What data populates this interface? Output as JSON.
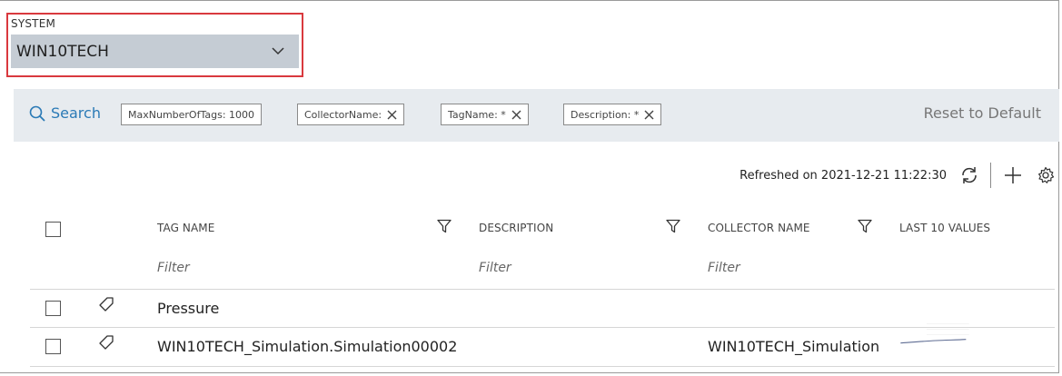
{
  "system": {
    "label": "SYSTEM",
    "selected": "WIN10TECH"
  },
  "search": {
    "link_label": "Search",
    "chips": [
      {
        "label": "MaxNumberOfTags: 1000",
        "removable": false
      },
      {
        "label": "CollectorName:",
        "removable": true
      },
      {
        "label": "TagName: *",
        "removable": true
      },
      {
        "label": "Description: *",
        "removable": true
      }
    ],
    "reset_label": "Reset to Default"
  },
  "toolbar": {
    "refreshed_text": "Refreshed on 2021-12-21 11:22:30",
    "icons": [
      "refresh-icon",
      "plus-icon",
      "gear-icon"
    ]
  },
  "table": {
    "columns": [
      "TAG NAME",
      "DESCRIPTION",
      "COLLECTOR NAME",
      "LAST 10 VALUES"
    ],
    "filter_placeholder": "Filter",
    "rows": [
      {
        "tag_name": "Pressure",
        "description": "",
        "collector_name": "",
        "has_sparkline": false
      },
      {
        "tag_name": "WIN10TECH_Simulation.Simulation00002",
        "description": "",
        "collector_name": "WIN10TECH_Simulation",
        "has_sparkline": true
      }
    ]
  },
  "colors": {
    "highlight_border": "#d9393e",
    "select_bg": "#c5ccd4",
    "search_bar_bg": "#e7ebef",
    "link_blue": "#2b7ab6"
  }
}
